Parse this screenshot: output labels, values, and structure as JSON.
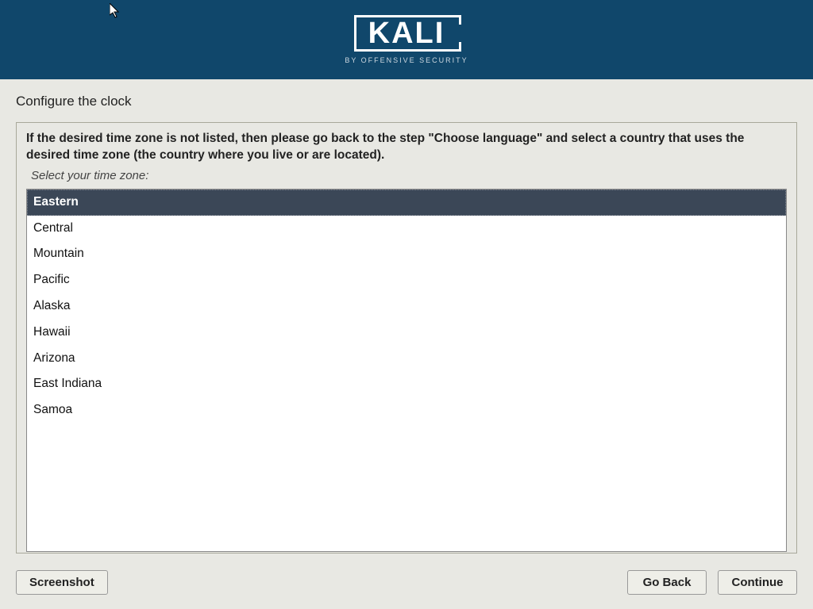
{
  "header": {
    "logo_text": "KALI",
    "logo_sub": "BY OFFENSIVE SECURITY"
  },
  "section_title": "Configure the clock",
  "info_text": "If the desired time zone is not listed, then please go back to the step \"Choose language\" and select a country that uses the desired time zone (the country where you live or are located).",
  "prompt_text": "Select your time zone:",
  "timezones": [
    {
      "label": "Eastern",
      "selected": true
    },
    {
      "label": "Central",
      "selected": false
    },
    {
      "label": "Mountain",
      "selected": false
    },
    {
      "label": "Pacific",
      "selected": false
    },
    {
      "label": "Alaska",
      "selected": false
    },
    {
      "label": "Hawaii",
      "selected": false
    },
    {
      "label": "Arizona",
      "selected": false
    },
    {
      "label": "East Indiana",
      "selected": false
    },
    {
      "label": "Samoa",
      "selected": false
    }
  ],
  "buttons": {
    "screenshot": "Screenshot",
    "go_back": "Go Back",
    "continue": "Continue"
  }
}
